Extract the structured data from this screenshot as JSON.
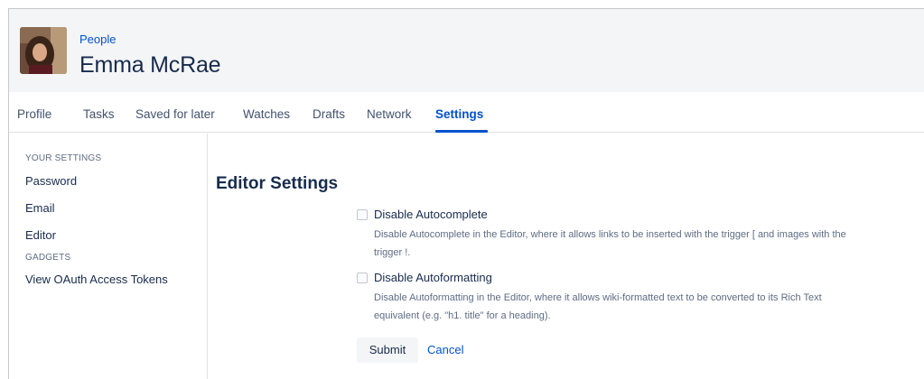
{
  "header": {
    "breadcrumb": "People",
    "title": "Emma McRae"
  },
  "tabs": [
    {
      "label": "Profile"
    },
    {
      "label": "Tasks"
    },
    {
      "label": "Saved for later"
    },
    {
      "label": "Watches"
    },
    {
      "label": "Drafts"
    },
    {
      "label": "Network"
    },
    {
      "label": "Settings",
      "active": true
    }
  ],
  "sidebar": {
    "settings_heading": "YOUR SETTINGS",
    "items": [
      {
        "label": "Password"
      },
      {
        "label": "Email"
      },
      {
        "label": "Editor"
      }
    ],
    "gadgets_heading": "GADGETS",
    "gadget_items": [
      {
        "label": "View OAuth Access Tokens"
      }
    ]
  },
  "content": {
    "title": "Editor Settings",
    "options": [
      {
        "label": "Disable Autocomplete",
        "checked": false,
        "description_line1": "Disable Autocomplete in the Editor, where it allows links to be inserted with the trigger [ and images with the",
        "description_line2": "trigger !."
      },
      {
        "label": "Disable Autoformatting",
        "checked": false,
        "description_line1": "Disable Autoformatting in the Editor, where it allows wiki-formatted text to be converted to its Rich Text",
        "description_line2": "equivalent (e.g. \"h1. title\" for a heading)."
      }
    ],
    "submit_label": "Submit",
    "cancel_label": "Cancel"
  },
  "colors": {
    "link": "#0052cc",
    "text": "#172b4d",
    "header_bg": "#f4f5f7"
  }
}
